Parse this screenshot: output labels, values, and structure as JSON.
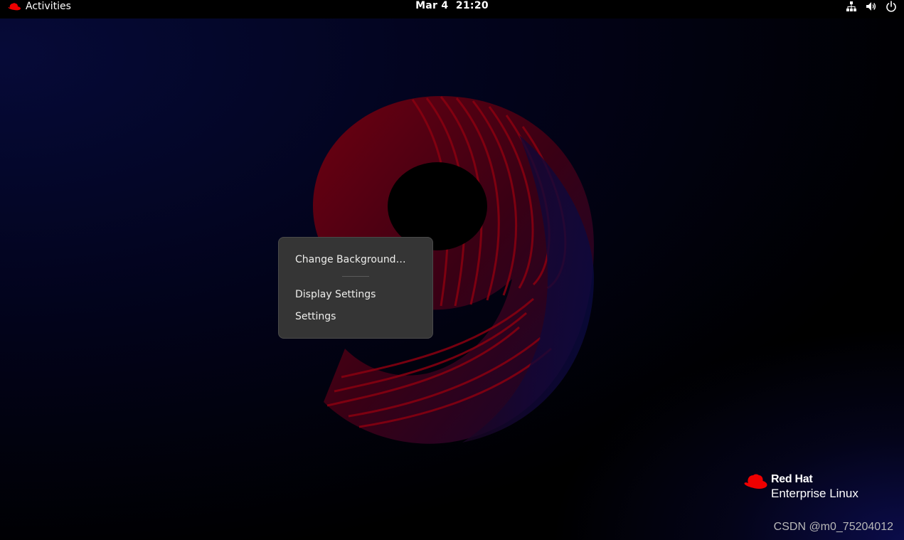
{
  "topbar": {
    "activities_label": "Activities",
    "clock_date": "Mar 4",
    "clock_time": "21:20"
  },
  "tray": {
    "icons": [
      "network-icon",
      "volume-icon",
      "power-icon"
    ]
  },
  "context_menu": {
    "items": [
      {
        "label": "Change Background…"
      },
      {
        "label": "Display Settings"
      },
      {
        "label": "Settings"
      }
    ]
  },
  "branding": {
    "line1": "Red Hat",
    "line2": "Enterprise Linux",
    "logo_color": "#ee0000"
  },
  "watermark": "CSDN @m0_75204012",
  "colors": {
    "menu_bg": "#353535",
    "wallpaper_red": "#8a0010",
    "wallpaper_blue": "#0b0c4a"
  }
}
